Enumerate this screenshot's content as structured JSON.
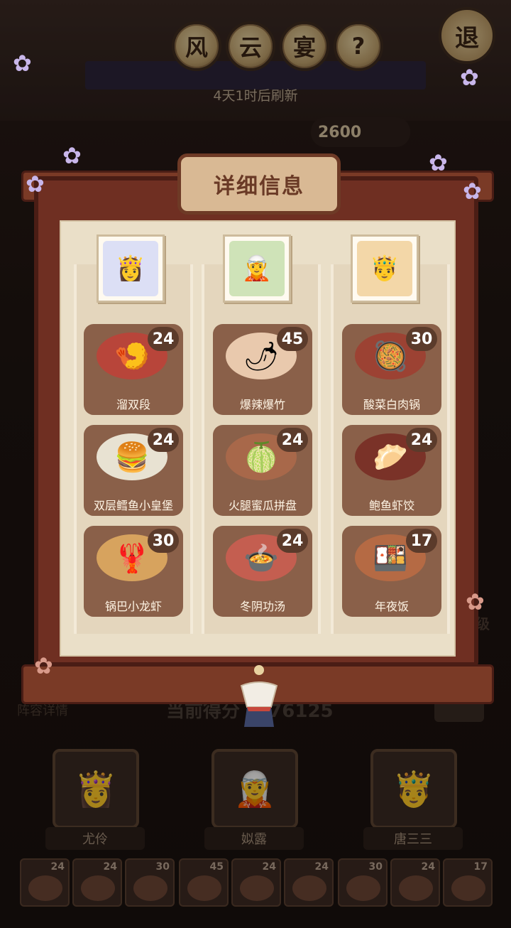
{
  "header": {
    "title_chars": [
      "风",
      "云",
      "宴"
    ],
    "help_label": "?",
    "exit_label": "退",
    "refresh_text": "4天1时后刷新",
    "score_partial": "2600"
  },
  "modal": {
    "title": "详细信息",
    "columns": [
      {
        "portrait": "character-portrait-white-hair",
        "dishes": [
          {
            "name": "溜双段",
            "count": "24"
          },
          {
            "name": "双层鳕鱼小皇堡",
            "count": "24"
          },
          {
            "name": "锅巴小龙虾",
            "count": "30"
          }
        ]
      },
      {
        "portrait": "character-portrait-green-hair",
        "dishes": [
          {
            "name": "爆辣爆竹",
            "count": "45"
          },
          {
            "name": "火腿蜜瓜拼盘",
            "count": "24"
          },
          {
            "name": "冬阴功汤",
            "count": "24"
          }
        ]
      },
      {
        "portrait": "character-portrait-golden-crown",
        "dishes": [
          {
            "name": "酸菜白肉锅",
            "count": "30"
          },
          {
            "name": "鲍鱼虾饺",
            "count": "24"
          },
          {
            "name": "年夜饭",
            "count": "17"
          }
        ]
      }
    ]
  },
  "bottom": {
    "lineup_detail": "阵容详情",
    "current_score_label": "当前得分",
    "current_score_value": "276125",
    "side_text": "级",
    "characters": [
      {
        "name": "尤伶"
      },
      {
        "name": "姒露"
      },
      {
        "name": "唐三三"
      }
    ],
    "mini_dishes": [
      "24",
      "24",
      "30",
      "45",
      "24",
      "24",
      "30",
      "24",
      "17"
    ]
  }
}
